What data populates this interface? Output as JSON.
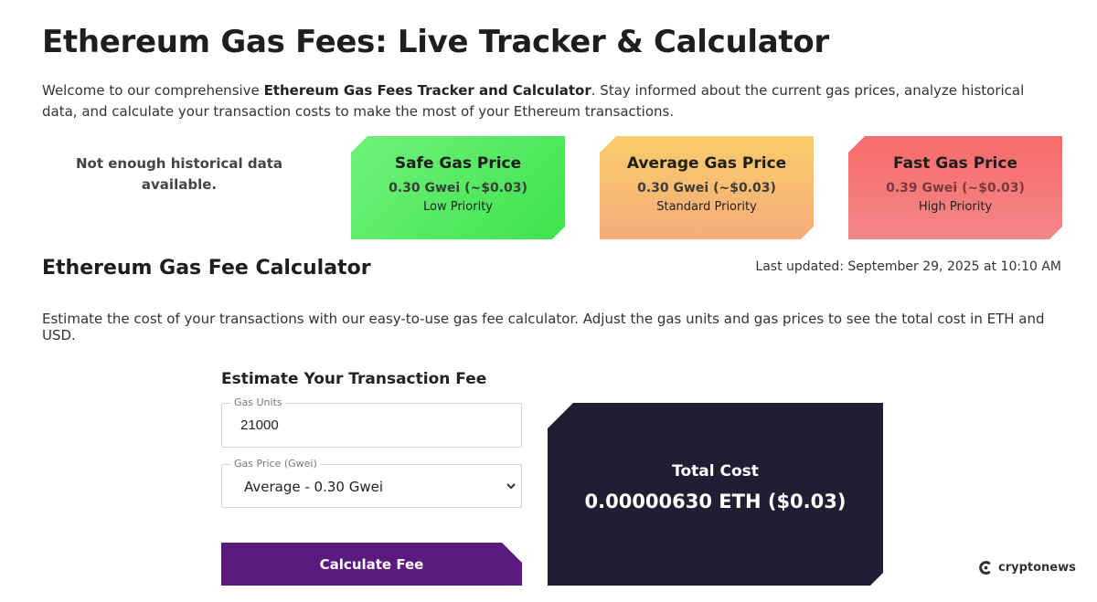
{
  "header": {
    "title": "Ethereum Gas Fees: Live Tracker & Calculator",
    "intro_before": "Welcome to our comprehensive ",
    "intro_bold": "Ethereum Gas Fees Tracker and Calculator",
    "intro_after": ". Stay informed about the current gas prices, analyze historical data, and calculate your transaction costs to make the most of your Ethereum transactions."
  },
  "history_notice": "Not enough historical data available.",
  "gas_cards": [
    {
      "title": "Safe Gas Price",
      "price": "0.30 Gwei (~$0.03)",
      "priority": "Low Priority",
      "color": "#4fe65b"
    },
    {
      "title": "Average Gas Price",
      "price": "0.30 Gwei (~$0.03)",
      "priority": "Standard Priority",
      "color": "#f8bd71"
    },
    {
      "title": "Fast Gas Price",
      "price": "0.39 Gwei (~$0.03)",
      "priority": "High Priority",
      "color": "#f57878"
    }
  ],
  "calculator": {
    "heading": "Ethereum Gas Fee Calculator",
    "last_updated": "Last updated: September 29, 2025 at 10:10 AM",
    "description": "Estimate the cost of your transactions with our easy-to-use gas fee calculator. Adjust the gas units and gas prices to see the total cost in ETH and USD.",
    "form_title": "Estimate Your Transaction Fee",
    "gas_units_label": "Gas Units",
    "gas_units_value": "21000",
    "gas_price_label": "Gas Price (Gwei)",
    "gas_price_selected": "Average - 0.30 Gwei",
    "button_label": "Calculate Fee",
    "accent_color": "#5b1b7e"
  },
  "result": {
    "label": "Total Cost",
    "value": "0.00000630 ETH ($0.03)",
    "panel_color": "#221d32"
  },
  "brand": {
    "name": "cryptonews",
    "icon": "cryptonews-logo-icon"
  }
}
